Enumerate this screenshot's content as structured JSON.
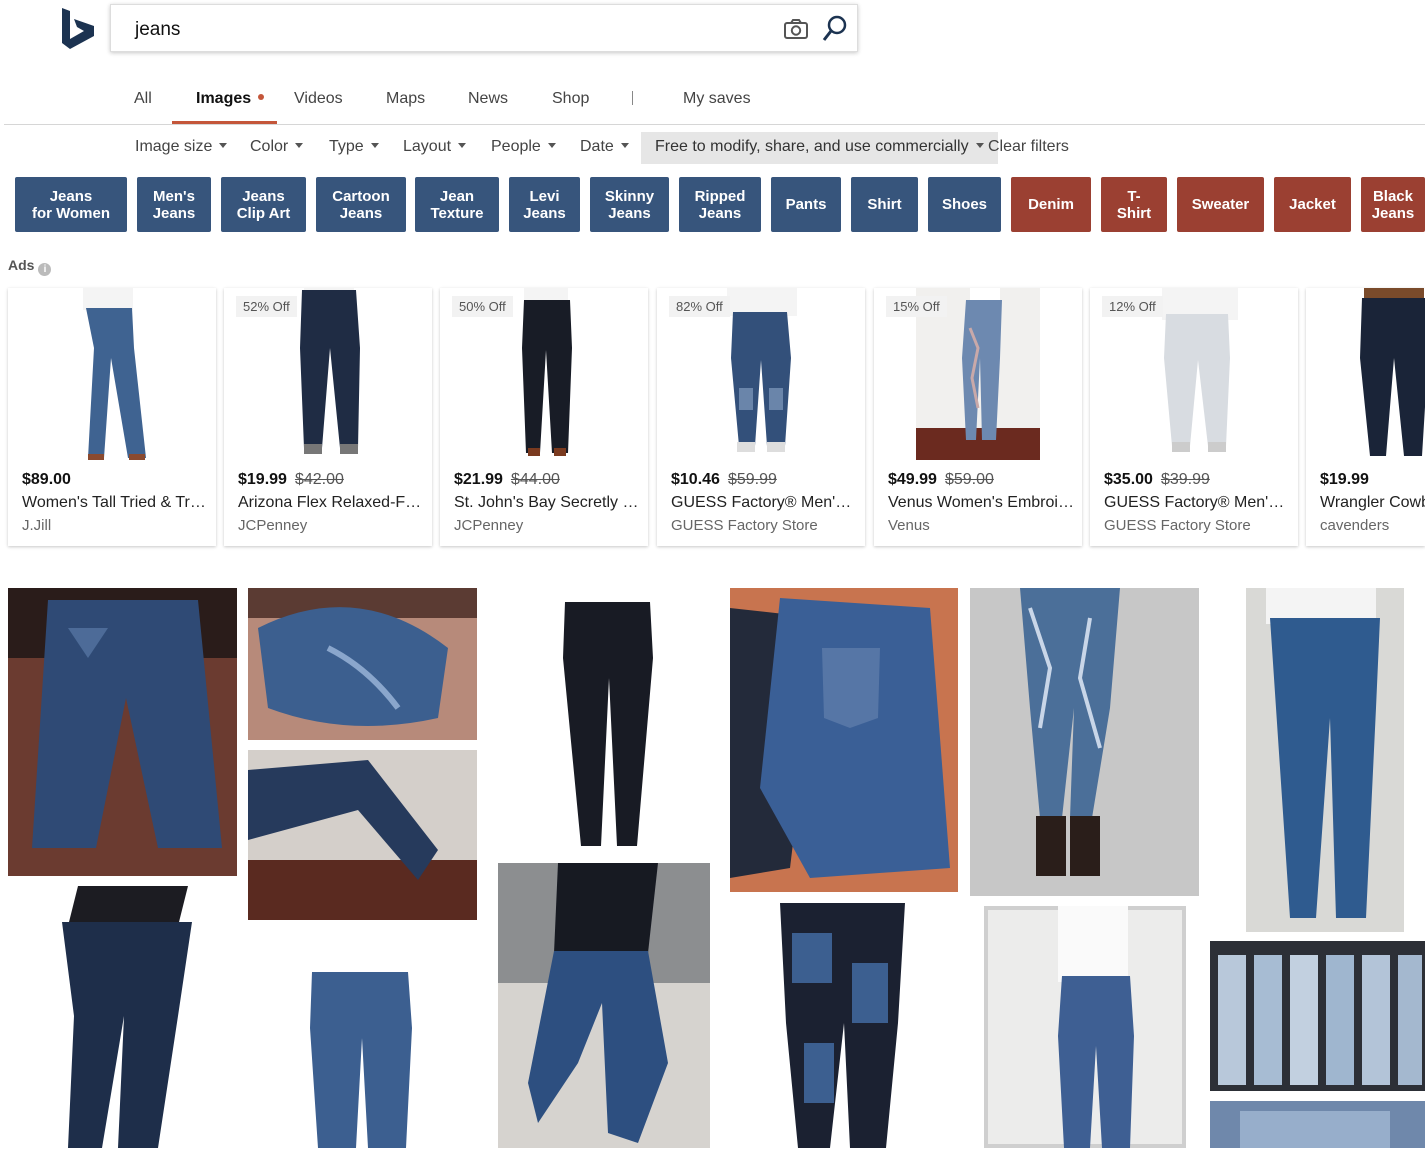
{
  "search": {
    "query": "jeans"
  },
  "tabs": [
    {
      "label": "All"
    },
    {
      "label": "Images"
    },
    {
      "label": "Videos"
    },
    {
      "label": "Maps"
    },
    {
      "label": "News"
    },
    {
      "label": "Shop"
    },
    {
      "label": "My saves"
    }
  ],
  "filters": {
    "image_size": "Image size",
    "color": "Color",
    "type": "Type",
    "layout": "Layout",
    "people": "People",
    "date": "Date",
    "license": "Free to modify, share, and use commercially",
    "clear": "Clear filters"
  },
  "chips": [
    {
      "label": "Jeans\nfor Women",
      "color": "#37557c"
    },
    {
      "label": "Men's\nJeans",
      "color": "#37557c"
    },
    {
      "label": "Jeans\nClip Art",
      "color": "#37557c"
    },
    {
      "label": "Cartoon\nJeans",
      "color": "#37557c"
    },
    {
      "label": "Jean\nTexture",
      "color": "#37557c"
    },
    {
      "label": "Levi\nJeans",
      "color": "#37557c"
    },
    {
      "label": "Skinny\nJeans",
      "color": "#37557c"
    },
    {
      "label": "Ripped\nJeans",
      "color": "#37557c"
    },
    {
      "label": "Pants",
      "color": "#37557c"
    },
    {
      "label": "Shirt",
      "color": "#37557c"
    },
    {
      "label": "Shoes",
      "color": "#37557c"
    },
    {
      "label": "Denim",
      "color": "#9b4032"
    },
    {
      "label": "T-\nShirt",
      "color": "#9b4032"
    },
    {
      "label": "Sweater",
      "color": "#9b4032"
    },
    {
      "label": "Jacket",
      "color": "#9b4032"
    },
    {
      "label": "Black\nJeans",
      "color": "#9b4032"
    }
  ],
  "ads": {
    "label": "Ads",
    "info_icon": "i",
    "products": [
      {
        "price": "$89.00",
        "old_price": "",
        "discount": "",
        "name": "Women's Tall Tried & True Straight-Leg Jeans",
        "seller": "J.Jill"
      },
      {
        "price": "$19.99",
        "old_price": "$42.00",
        "discount": "52% Off",
        "name": "Arizona Flex Relaxed-Fit Jeans",
        "seller": "JCPenney"
      },
      {
        "price": "$21.99",
        "old_price": "$44.00",
        "discount": "50% Off",
        "name": "St. John's Bay Secretly Slender Jeans",
        "seller": "JCPenney"
      },
      {
        "price": "$10.46",
        "old_price": "$59.99",
        "discount": "82% Off",
        "name": "GUESS Factory® Men's Jeans",
        "seller": "GUESS Factory Store"
      },
      {
        "price": "$49.99",
        "old_price": "$59.00",
        "discount": "15% Off",
        "name": "Venus Women's Embroidered Jeans",
        "seller": "Venus"
      },
      {
        "price": "$35.00",
        "old_price": "$39.99",
        "discount": "12% Off",
        "name": "GUESS Factory® Men's Jeans",
        "seller": "GUESS Factory Store"
      },
      {
        "price": "$19.99",
        "old_price": "",
        "discount": "",
        "name": "Wrangler Cowboy Cut",
        "seller": "cavenders"
      }
    ]
  },
  "colors": {
    "accent": "#c4563a",
    "chip_blue": "#37557c",
    "chip_red": "#9b4032",
    "denim": "#3a5a86"
  }
}
